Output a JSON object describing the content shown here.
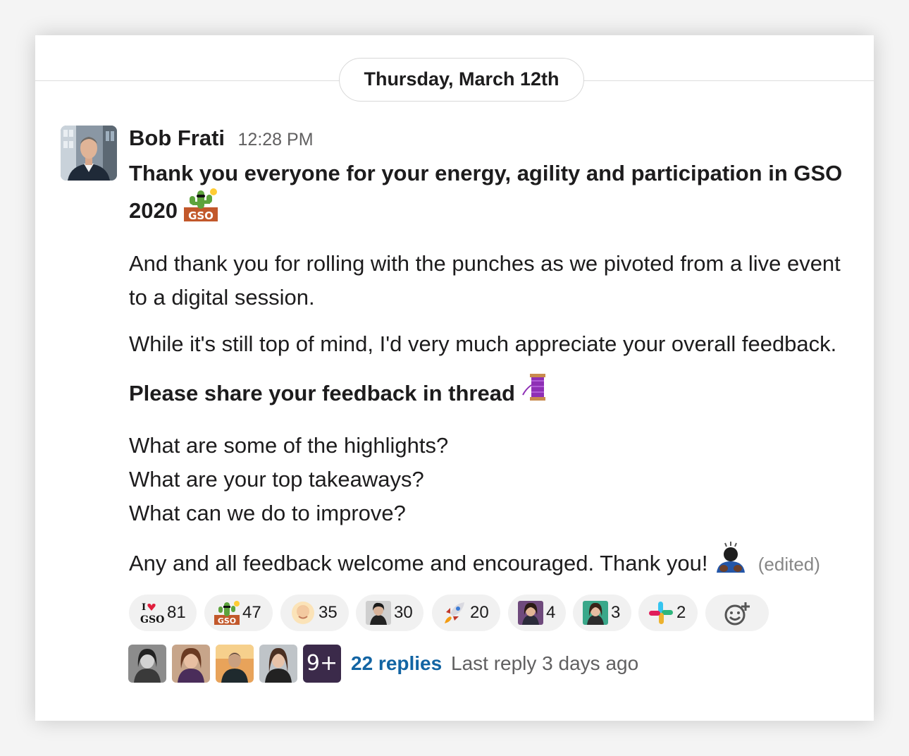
{
  "date_divider": "Thursday, March 12th",
  "message": {
    "sender": "Bob Frati",
    "time": "12:28 PM",
    "paragraphs": {
      "p1": "Thank you everyone for your energy, agility and participation in GSO 2020",
      "p2": "And thank you for rolling with the punches as we pivoted from a live event to a digital session.",
      "p3": "While it's still top of mind, I'd very much appreciate your overall feedback.",
      "p4": "Please share your feedback in thread",
      "p5_line1": "What are some of the highlights?",
      "p5_line2": "What are your top takeaways?",
      "p5_line3": "What can we do to improve?",
      "p6": "Any and all feedback welcome and encouraged. Thank you!"
    },
    "edited_label": "(edited)",
    "emoji": {
      "gso_cactus": "gso-cactus-icon",
      "thread_spool": "thread-spool-icon",
      "bowing_person": "bowing-person-icon",
      "gso_text": "GSO",
      "love_gso_text": "I",
      "love_gso_bottom": "GSO"
    }
  },
  "reactions": {
    "r0": {
      "icon": "i-love-gso-icon",
      "count": "81"
    },
    "r1": {
      "icon": "gso-cactus-icon",
      "count": "47"
    },
    "r2": {
      "icon": "face-avatar-icon",
      "count": "35"
    },
    "r3": {
      "icon": "person-photo-icon",
      "count": "30"
    },
    "r4": {
      "icon": "rocket-icon",
      "count": "20"
    },
    "r5": {
      "icon": "person-photo-icon",
      "count": "4"
    },
    "r6": {
      "icon": "person-photo-icon",
      "count": "3"
    },
    "r7": {
      "icon": "slack-logo-icon",
      "count": "2"
    },
    "add": {
      "icon": "add-reaction-icon"
    }
  },
  "thread": {
    "more_avatars": "9+",
    "reply_count": "22 replies",
    "last_reply": "Last reply 3 days ago"
  },
  "colors": {
    "link": "#1264a3",
    "reaction_bg": "#f1f1f1",
    "muted_text": "#616061"
  }
}
